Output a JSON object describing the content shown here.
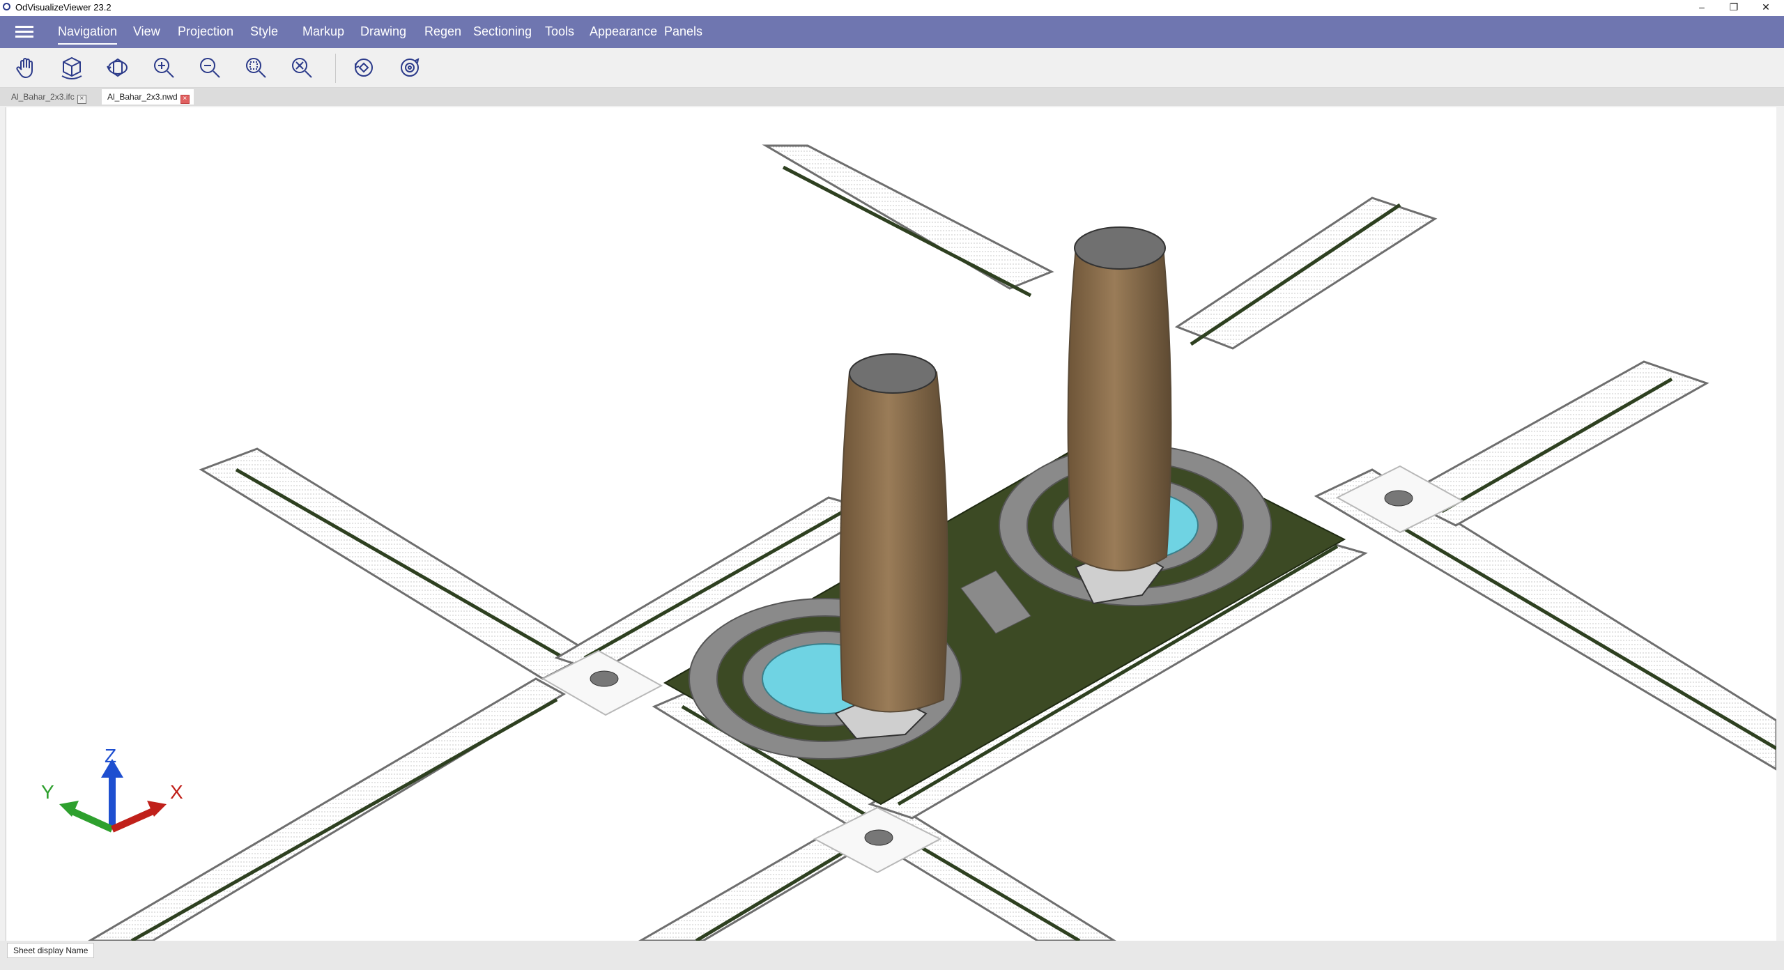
{
  "window": {
    "title": "OdVisualizeViewer 23.2",
    "minimize": "–",
    "restore": "❐",
    "close": "✕"
  },
  "menu": {
    "items": [
      {
        "label": "Navigation"
      },
      {
        "label": "View"
      },
      {
        "label": "Projection"
      },
      {
        "label": "Style"
      },
      {
        "label": "Markup"
      },
      {
        "label": "Drawing"
      },
      {
        "label": "Regen"
      },
      {
        "label": "Sectioning"
      },
      {
        "label": "Tools"
      },
      {
        "label": "Appearance"
      },
      {
        "label": "Panels"
      }
    ],
    "active": "Navigation"
  },
  "toolbar": {
    "tools": [
      "pan-icon",
      "orbit-box-icon",
      "orbit-icon",
      "zoom-in-icon",
      "zoom-out-icon",
      "zoom-window-icon",
      "zoom-extents-icon",
      "rotate-view-icon",
      "turntable-icon"
    ]
  },
  "tabs": [
    {
      "label": "Al_Bahar_2x3.ifc",
      "active": false
    },
    {
      "label": "Al_Bahar_2x3.nwd",
      "active": true
    }
  ],
  "axes": {
    "z": "Z",
    "y": "Y",
    "x": "X"
  },
  "status": {
    "sheet_label": "Sheet display Name"
  },
  "colors": {
    "menu_bg": "#6f76b0",
    "road_gray": "#6e6e6e",
    "median_green": "#2e4020",
    "grass": "#3c4a24",
    "plaza": "#8a8a8a",
    "water": "#6fd3e3",
    "tower": "#8a6e4e",
    "axis_x": "#c0201a",
    "axis_y": "#2ea02e",
    "axis_z": "#1e4fd0"
  }
}
